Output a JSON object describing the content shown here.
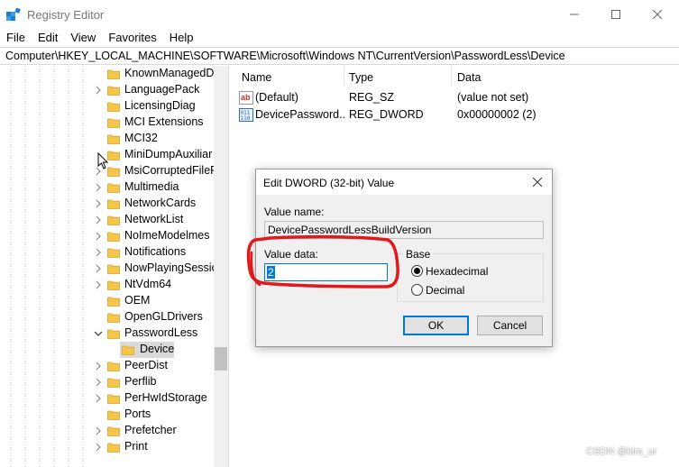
{
  "window": {
    "title": "Registry Editor"
  },
  "menu": [
    "File",
    "Edit",
    "View",
    "Favorites",
    "Help"
  ],
  "address": "Computer\\HKEY_LOCAL_MACHINE\\SOFTWARE\\Microsoft\\Windows NT\\CurrentVersion\\PasswordLess\\Device",
  "tree": {
    "items": [
      {
        "label": "KnownManagedDe",
        "chevron": "none"
      },
      {
        "label": "LanguagePack",
        "chevron": "right"
      },
      {
        "label": "LicensingDiag",
        "chevron": "none"
      },
      {
        "label": "MCI Extensions",
        "chevron": "none"
      },
      {
        "label": "MCI32",
        "chevron": "none"
      },
      {
        "label": "MiniDumpAuxiliar",
        "chevron": "none"
      },
      {
        "label": "MsiCorruptedFileR",
        "chevron": "right"
      },
      {
        "label": "Multimedia",
        "chevron": "right"
      },
      {
        "label": "NetworkCards",
        "chevron": "right"
      },
      {
        "label": "NetworkList",
        "chevron": "right"
      },
      {
        "label": "NoImeModelmes",
        "chevron": "right"
      },
      {
        "label": "Notifications",
        "chevron": "right"
      },
      {
        "label": "NowPlayingSessior",
        "chevron": "right"
      },
      {
        "label": "NtVdm64",
        "chevron": "right"
      },
      {
        "label": "OEM",
        "chevron": "none"
      },
      {
        "label": "OpenGLDrivers",
        "chevron": "none"
      },
      {
        "label": "PasswordLess",
        "chevron": "down"
      },
      {
        "label": "Device",
        "chevron": "none",
        "child": true,
        "selected": true
      },
      {
        "label": "PeerDist",
        "chevron": "right"
      },
      {
        "label": "Perflib",
        "chevron": "right"
      },
      {
        "label": "PerHwIdStorage",
        "chevron": "right"
      },
      {
        "label": "Ports",
        "chevron": "none"
      },
      {
        "label": "Prefetcher",
        "chevron": "right"
      },
      {
        "label": "Print",
        "chevron": "right"
      }
    ]
  },
  "list": {
    "columns": [
      "Name",
      "Type",
      "Data"
    ],
    "rows": [
      {
        "icon": "string-value-icon",
        "name": "(Default)",
        "type": "REG_SZ",
        "data": "(value not set)"
      },
      {
        "icon": "binary-value-icon",
        "name": "DevicePasswordLessBuildVersion",
        "name_display": "DevicePassword...",
        "type": "REG_DWORD",
        "data": "0x00000002 (2)"
      }
    ]
  },
  "dialog": {
    "title": "Edit DWORD (32-bit) Value",
    "value_name_label": "Value name:",
    "value_name": "DevicePasswordLessBuildVersion",
    "value_data_label": "Value data:",
    "value_data": "2",
    "base_label": "Base",
    "base_options": [
      "Hexadecimal",
      "Decimal"
    ],
    "base_selected": "Hexadecimal",
    "ok_label": "OK",
    "cancel_label": "Cancel"
  },
  "watermark": "CSDN @kirs_ur",
  "colors": {
    "accent": "#0078d7",
    "annotation": "#e0191d",
    "folder": "#f5c64a"
  }
}
